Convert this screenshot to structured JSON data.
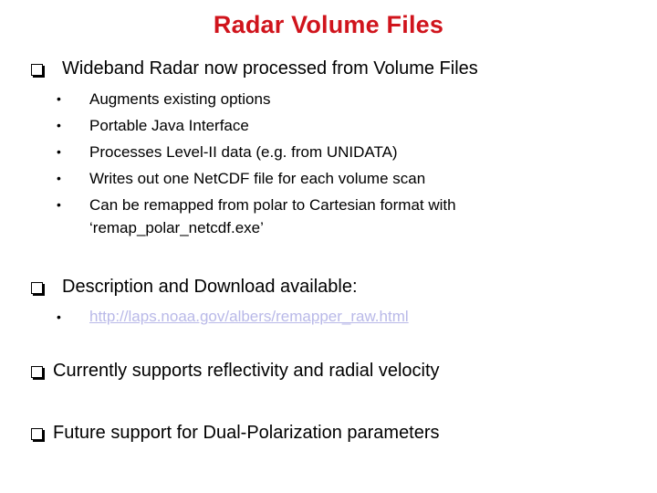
{
  "title": "Radar Volume Files",
  "colors": {
    "title": "#d0141c",
    "link": "#b9b9e8"
  },
  "sections": [
    {
      "icon": "checkbox-square-icon",
      "text": "Wideband Radar now processed from Volume Files",
      "bullets": [
        "Augments existing options",
        "Portable Java Interface",
        "Processes Level-II data (e.g. from UNIDATA)",
        "Writes out one NetCDF file for each volume scan",
        "Can be remapped from polar to Cartesian format with",
        "‘remap_polar_netcdf.exe’"
      ]
    },
    {
      "icon": "checkbox-square-icon",
      "text": "Description and Download available:",
      "link": "http://laps.noaa.gov/albers/remapper_raw.html"
    },
    {
      "icon": "checkbox-square-icon",
      "text": "Currently supports reflectivity and radial velocity"
    },
    {
      "icon": "checkbox-square-icon",
      "text": "Future support for Dual-Polarization parameters"
    }
  ]
}
